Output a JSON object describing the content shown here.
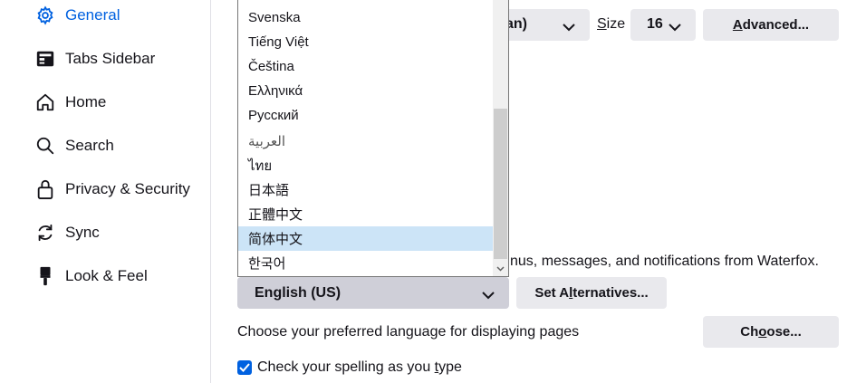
{
  "sidebar": {
    "items": [
      {
        "label": "General",
        "icon": "gear-icon",
        "selected": true
      },
      {
        "label": "Tabs Sidebar",
        "icon": "tabs-sidebar-icon"
      },
      {
        "label": "Home",
        "icon": "home-icon"
      },
      {
        "label": "Search",
        "icon": "search-icon"
      },
      {
        "label": "Privacy & Security",
        "icon": "lock-icon"
      },
      {
        "label": "Sync",
        "icon": "sync-icon"
      },
      {
        "label": "Look & Feel",
        "icon": "paintbrush-icon"
      }
    ]
  },
  "fonts": {
    "default_font_tail": "an)",
    "size_label_underlined": "S",
    "size_label_rest": "ize",
    "size_value": "16",
    "advanced_label_underlined": "A",
    "advanced_label_rest": "dvanced..."
  },
  "language": {
    "description_visible": "nus, messages, and notifications from Waterfox.",
    "selected_language": "English (US)",
    "set_alternatives_pre": "Set A",
    "set_alternatives_underlined": "l",
    "set_alternatives_post": "ternatives...",
    "dropdown_options": [
      "Svenska",
      "Tiếng Việt",
      "Čeština",
      "Ελληνικά",
      "Русский",
      "العربية",
      "ไทย",
      "日本語",
      "正體中文",
      "简体中文",
      "한국어"
    ],
    "highlighted_option": "简体中文"
  },
  "pages_language": {
    "description": "Choose your preferred language for displaying pages",
    "choose_pre": "Ch",
    "choose_underlined": "o",
    "choose_post": "ose..."
  },
  "spelling": {
    "label_pre": "Check your spelling as you ",
    "label_underlined": "t",
    "label_post": "ype",
    "checked": true
  },
  "colors": {
    "accent": "#0061e0",
    "button_bg": "#e9e9ed",
    "highlight": "#cce4f7"
  }
}
